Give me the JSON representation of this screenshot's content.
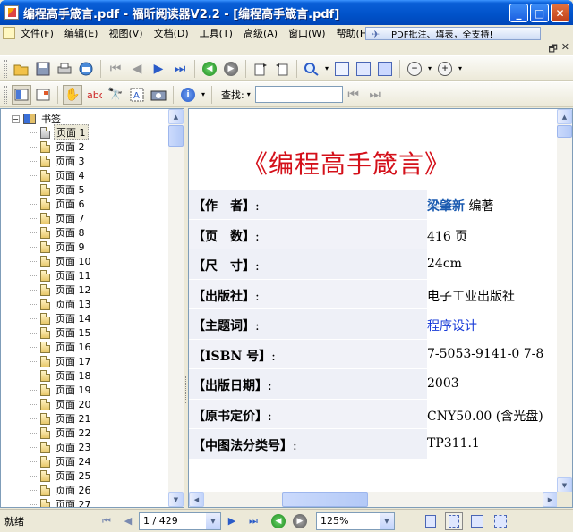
{
  "window": {
    "title": "编程高手箴言.pdf - 福昕阅读器V2.2 - [编程高手箴言.pdf]",
    "minimize_label": "_",
    "maximize_label": "□",
    "close_label": "✕"
  },
  "menu": {
    "items": [
      "文件(F)",
      "编辑(E)",
      "视图(V)",
      "文档(D)",
      "工具(T)",
      "高级(A)",
      "窗口(W)",
      "帮助(H)"
    ],
    "promo": "PDF批注、填表，全支持!",
    "promo_icon": "✈",
    "mdi_restore": "🗗",
    "mdi_close": "✕"
  },
  "toolbar": {
    "search_label": "查找:",
    "search_value": ""
  },
  "bookmarks": {
    "root_label": "书签",
    "items": [
      "页面 1",
      "页面 2",
      "页面 3",
      "页面 4",
      "页面 5",
      "页面 6",
      "页面 7",
      "页面 8",
      "页面 9",
      "页面 10",
      "页面 11",
      "页面 12",
      "页面 13",
      "页面 14",
      "页面 15",
      "页面 16",
      "页面 17",
      "页面 18",
      "页面 19",
      "页面 20",
      "页面 21",
      "页面 22",
      "页面 23",
      "页面 24",
      "页面 25",
      "页面 26",
      "页面 27"
    ],
    "selected_index": 0
  },
  "document": {
    "title": "《编程高手箴言》",
    "rows": [
      {
        "key": "【作　者】",
        "colon": ":",
        "value": "梁肇新",
        "suffix": " 编著"
      },
      {
        "key": "【页　数】",
        "colon": ":",
        "value": "416 页"
      },
      {
        "key": "【尺　寸】",
        "colon": ":",
        "value": "24cm"
      },
      {
        "key": "【出版社】",
        "colon": ":",
        "value": "电子工业出版社"
      },
      {
        "key": "【主题词】",
        "colon": ":",
        "value": "程序设计"
      },
      {
        "key": "【ISBN 号】",
        "colon": ":",
        "value": "7-5053-9141-0 7-8"
      },
      {
        "key": "【出版日期】",
        "colon": ":",
        "value": "2003"
      },
      {
        "key": "【原书定价】",
        "colon": ":",
        "value": "CNY50.00 (含光盘)"
      },
      {
        "key": "【中图法分类号】",
        "colon": ":",
        "value": "TP311.1"
      }
    ]
  },
  "statusbar": {
    "status": "就绪",
    "page": "1 / 429",
    "zoom": "125%"
  }
}
